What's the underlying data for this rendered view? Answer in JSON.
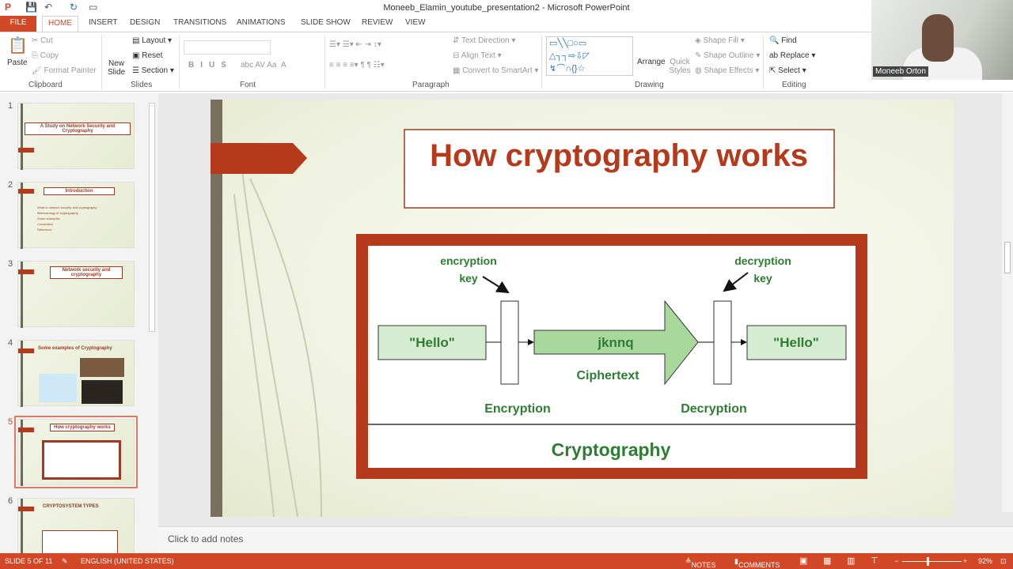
{
  "window": {
    "title": "Moneeb_Elamin_youtube_presentation2 - Microsoft PowerPoint"
  },
  "tabs": [
    "FILE",
    "HOME",
    "INSERT",
    "DESIGN",
    "TRANSITIONS",
    "ANIMATIONS",
    "SLIDE SHOW",
    "REVIEW",
    "VIEW"
  ],
  "ribbon": {
    "clipboard": {
      "paste": "Paste",
      "cut": "Cut",
      "copy": "Copy",
      "format_painter": "Format Painter",
      "label": "Clipboard"
    },
    "slides": {
      "new_slide": "New Slide",
      "layout": "Layout",
      "reset": "Reset",
      "section": "Section",
      "label": "Slides"
    },
    "font": {
      "label": "Font",
      "bold": "B",
      "italic": "I",
      "underline": "U",
      "shadow": "S",
      "strike": "abc",
      "spacing": "AV",
      "case": "Aa",
      "color": "A"
    },
    "paragraph": {
      "label": "Paragraph",
      "text_direction": "Text Direction",
      "align_text": "Align Text",
      "smartart": "Convert to SmartArt"
    },
    "drawing": {
      "label": "Drawing",
      "arrange": "Arrange",
      "quick_styles": "Quick Styles",
      "shape_fill": "Shape Fill",
      "shape_outline": "Shape Outline",
      "shape_effects": "Shape Effects"
    },
    "editing": {
      "label": "Editing",
      "find": "Find",
      "replace": "Replace",
      "select": "Select"
    }
  },
  "webcam": {
    "name": "Moneeb Orton"
  },
  "thumbnails": [
    {
      "num": "1",
      "title": "A Study on Network Security and Cryptography"
    },
    {
      "num": "2",
      "title": "Introduction",
      "bullets": [
        "What is network security and cryptography",
        "Methodology of cryptography",
        "Some examples",
        "Conclusion",
        "Reference"
      ]
    },
    {
      "num": "3",
      "title": "Network security and cryptography"
    },
    {
      "num": "4",
      "title": "Some examples of Cryptography"
    },
    {
      "num": "5",
      "title": "How cryptography works"
    },
    {
      "num": "6",
      "title": "CRYPTOSYSTEM TYPES"
    }
  ],
  "slide": {
    "title": "How cryptography works",
    "diagram": {
      "plain_left": "\"Hello\"",
      "plain_right": "\"Hello\"",
      "enc_key": "encryption",
      "dec_key": "decryption",
      "key": "key",
      "cipher": "jknnq",
      "cipher_label": "Ciphertext",
      "encryption": "Encryption",
      "decryption": "Decryption",
      "footer": "Cryptography"
    }
  },
  "notes": {
    "placeholder": "Click to add notes"
  },
  "status": {
    "slide": "SLIDE 5 OF 11",
    "language": "ENGLISH (UNITED STATES)",
    "notes": "NOTES",
    "comments": "COMMENTS",
    "zoom": "92%"
  },
  "colors": {
    "accent": "#d24726",
    "slide_red": "#b5391b",
    "green": "#2e7d32",
    "green_fill": "#d5ecd0"
  }
}
